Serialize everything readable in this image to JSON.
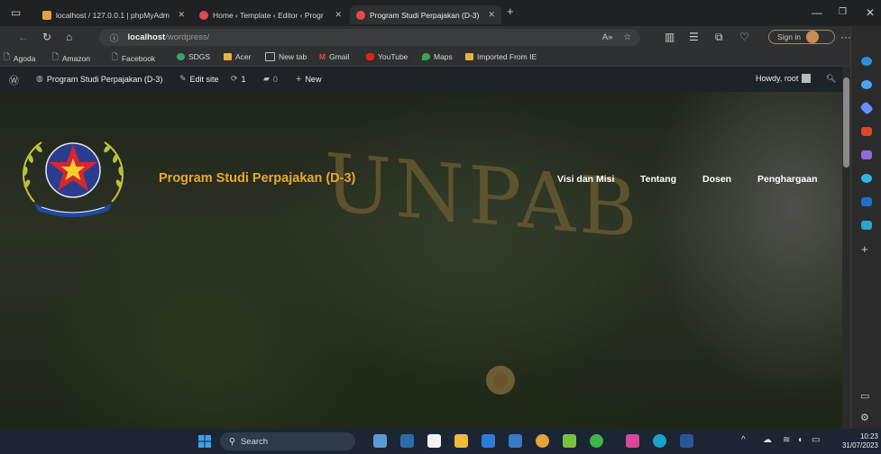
{
  "browser": {
    "tabs": [
      {
        "label": "localhost / 127.0.0.1 | phpMyAdm",
        "icon": "phpmyadmin-icon"
      },
      {
        "label": "Home ‹ Template ‹ Editor ‹ Progr",
        "icon": "site-icon"
      },
      {
        "label": "Program Studi Perpajakan (D-3)",
        "icon": "site-icon"
      }
    ],
    "new_tab": "+",
    "address": {
      "host": "localhost",
      "path": "/wordpress/"
    },
    "sign_in": "Sign in",
    "bookmarks": [
      {
        "label": "Agoda",
        "icon": "page-icon"
      },
      {
        "label": "Amazon",
        "icon": "page-icon"
      },
      {
        "label": "Facebook",
        "icon": "page-icon"
      },
      {
        "label": "SDGS",
        "icon": "sdgs-icon"
      },
      {
        "label": "Acer",
        "icon": "folder-icon"
      },
      {
        "label": "New tab",
        "icon": "newtab-icon"
      },
      {
        "label": "Gmail",
        "icon": "gmail-icon"
      },
      {
        "label": "YouTube",
        "icon": "youtube-icon"
      },
      {
        "label": "Maps",
        "icon": "maps-icon"
      },
      {
        "label": "Imported From IE",
        "icon": "folder-icon"
      }
    ]
  },
  "admin_bar": {
    "site_name": "Program Studi Perpajakan (D-3)",
    "edit_site": "Edit site",
    "updates": "1",
    "comments": "0",
    "new": "New",
    "howdy": "Howdy, root"
  },
  "site": {
    "title": "Program Studi Perpajakan (D-3)",
    "hero_sign": "UNPAB",
    "menu": [
      "Visi dan Misi",
      "Tentang",
      "Dosen",
      "Penghargaan"
    ]
  },
  "taskbar": {
    "search": "Search",
    "time": "10:23",
    "date": "31/07/2023"
  },
  "colors": {
    "title_accent": "#e8a92c",
    "admin_bar": "#1d2327",
    "browser_chrome": "#2f3031"
  }
}
